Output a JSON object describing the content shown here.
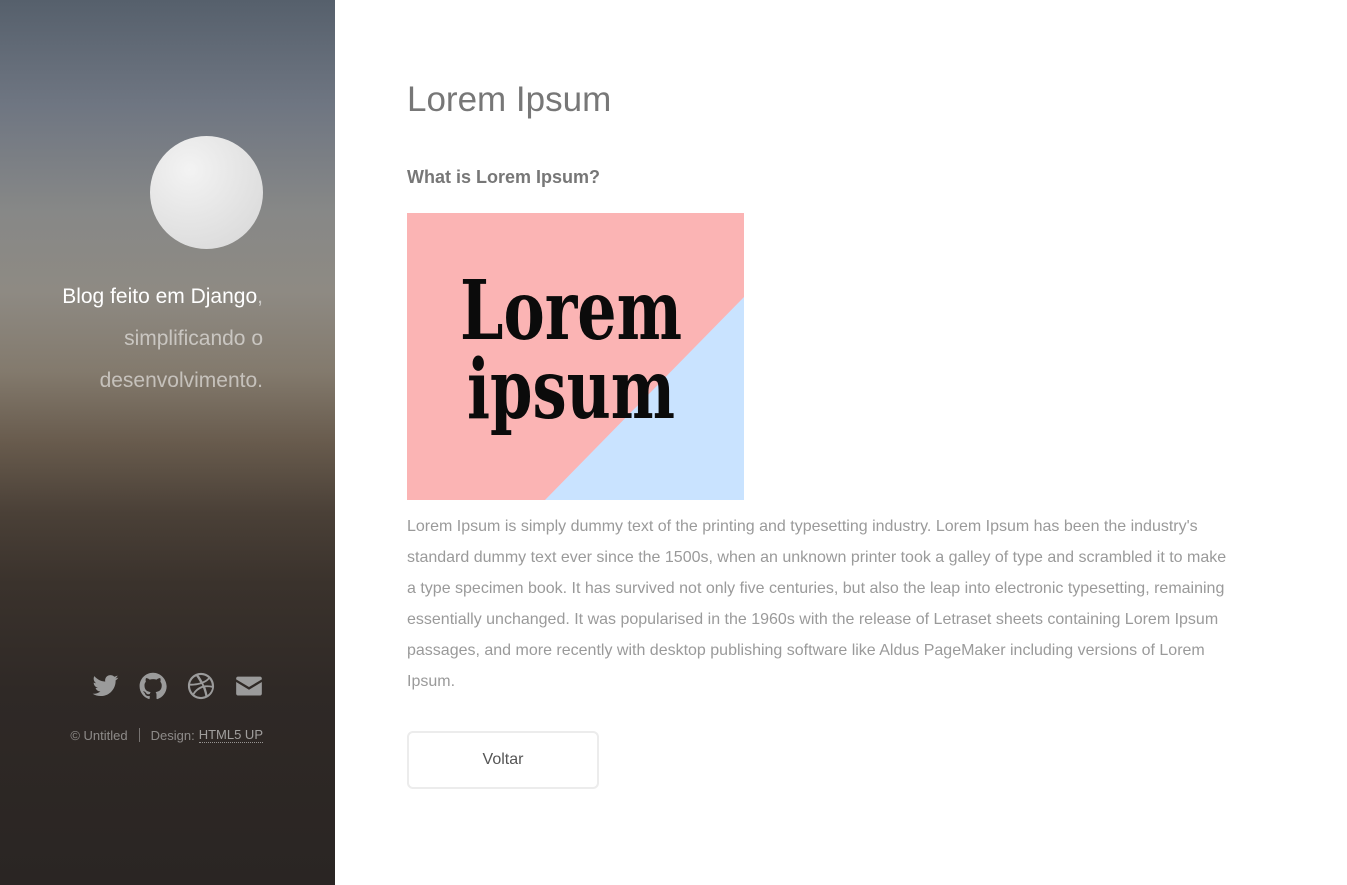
{
  "sidebar": {
    "tagline_strong": "Blog feito em Django",
    "tagline_rest": ", simplificando o desenvolvimento.",
    "social": [
      {
        "name": "twitter",
        "icon": "twitter-icon"
      },
      {
        "name": "github",
        "icon": "github-icon"
      },
      {
        "name": "dribbble",
        "icon": "dribbble-icon"
      },
      {
        "name": "email",
        "icon": "envelope-icon"
      }
    ],
    "copyright": "© Untitled",
    "design_label": "Design:",
    "design_link": "HTML5 UP"
  },
  "main": {
    "title": "Lorem Ipsum",
    "subtitle": "What is Lorem Ipsum?",
    "image": {
      "line1": "Lorem",
      "line2": "ipsum",
      "colors": {
        "pink": "#fbb4b4",
        "blue": "#c9e3ff",
        "text": "#0b0b0b"
      }
    },
    "body": "Lorem Ipsum is simply dummy text of the printing and typesetting industry. Lorem Ipsum has been the industry's standard dummy text ever since the 1500s, when an unknown printer took a galley of type and scrambled it to make a type specimen book. It has survived not only five centuries, but also the leap into electronic typesetting, remaining essentially unchanged. It was popularised in the 1960s with the release of Letraset sheets containing Lorem Ipsum passages, and more recently with desktop publishing software like Aldus PageMaker including versions of Lorem Ipsum.",
    "back_button": "Voltar"
  }
}
